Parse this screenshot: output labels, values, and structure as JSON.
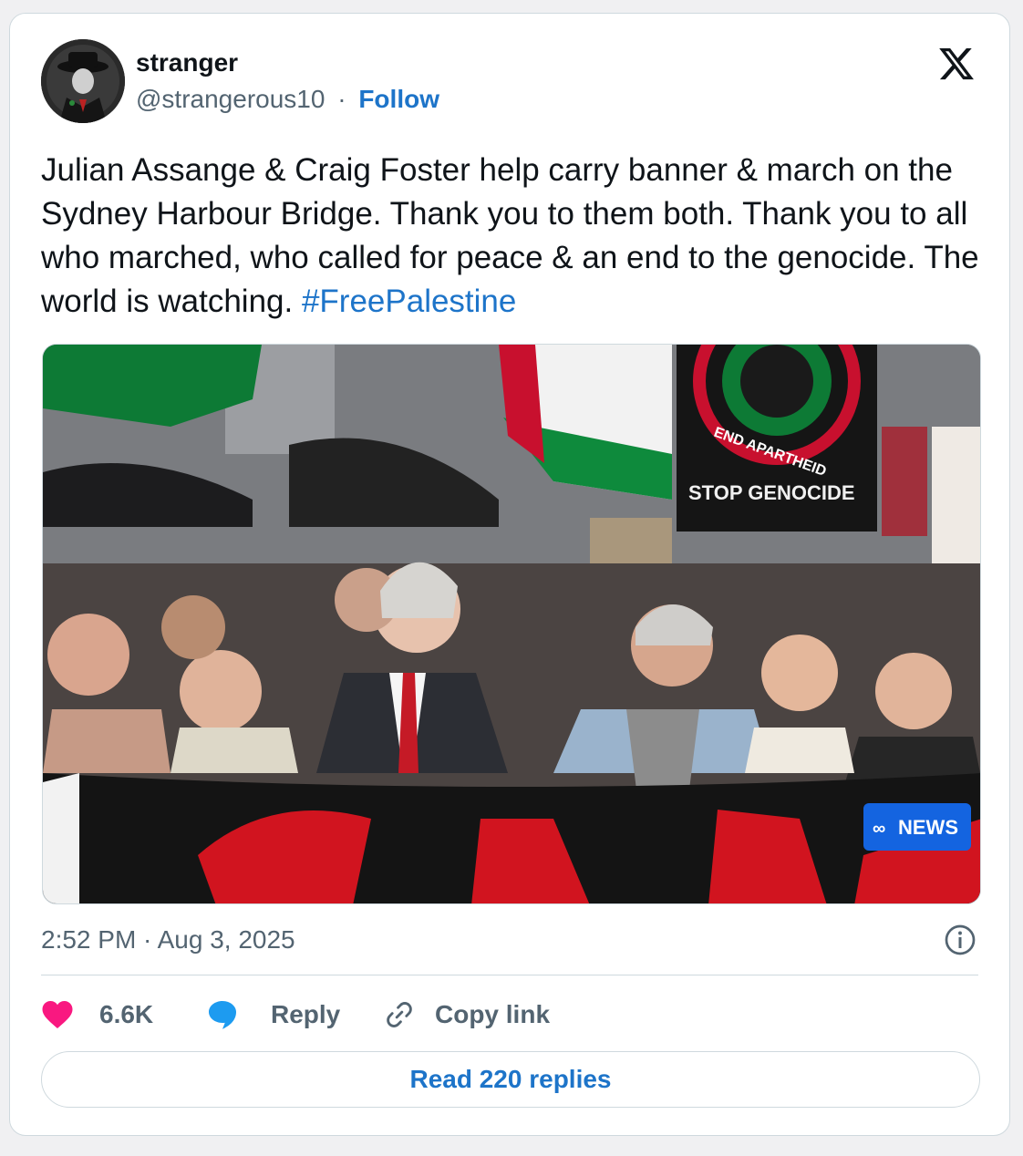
{
  "author": {
    "name": "stranger",
    "handle": "@strangerous10",
    "separator": "·",
    "follow_label": "Follow"
  },
  "tweet": {
    "text": "Julian Assange & Craig Foster help carry banner & march on the Sydney Harbour Bridge. Thank you to them both. Thank you to all who marched, who called for peace & an end to the genocide. The world is watching. ",
    "hashtag": "#FreePalestine"
  },
  "media": {
    "sign_end_apartheid": "END APARTHEID",
    "sign_stop_genocide": "STOP GENOCIDE",
    "news_badge": "NEWS"
  },
  "meta": {
    "timestamp": "2:52 PM · Aug 3, 2025"
  },
  "actions": {
    "like_count": "6.6K",
    "reply_label": "Reply",
    "copy_link_label": "Copy link"
  },
  "footer": {
    "read_replies_label": "Read 220 replies"
  },
  "colors": {
    "link": "#1d74c9",
    "like": "#f91880",
    "reply_icon": "#1d9bf0",
    "muted": "#536471",
    "border": "#cfd9de"
  },
  "icons": [
    "x-logo-icon",
    "heart-icon",
    "reply-bubble-icon",
    "link-icon",
    "info-icon"
  ]
}
